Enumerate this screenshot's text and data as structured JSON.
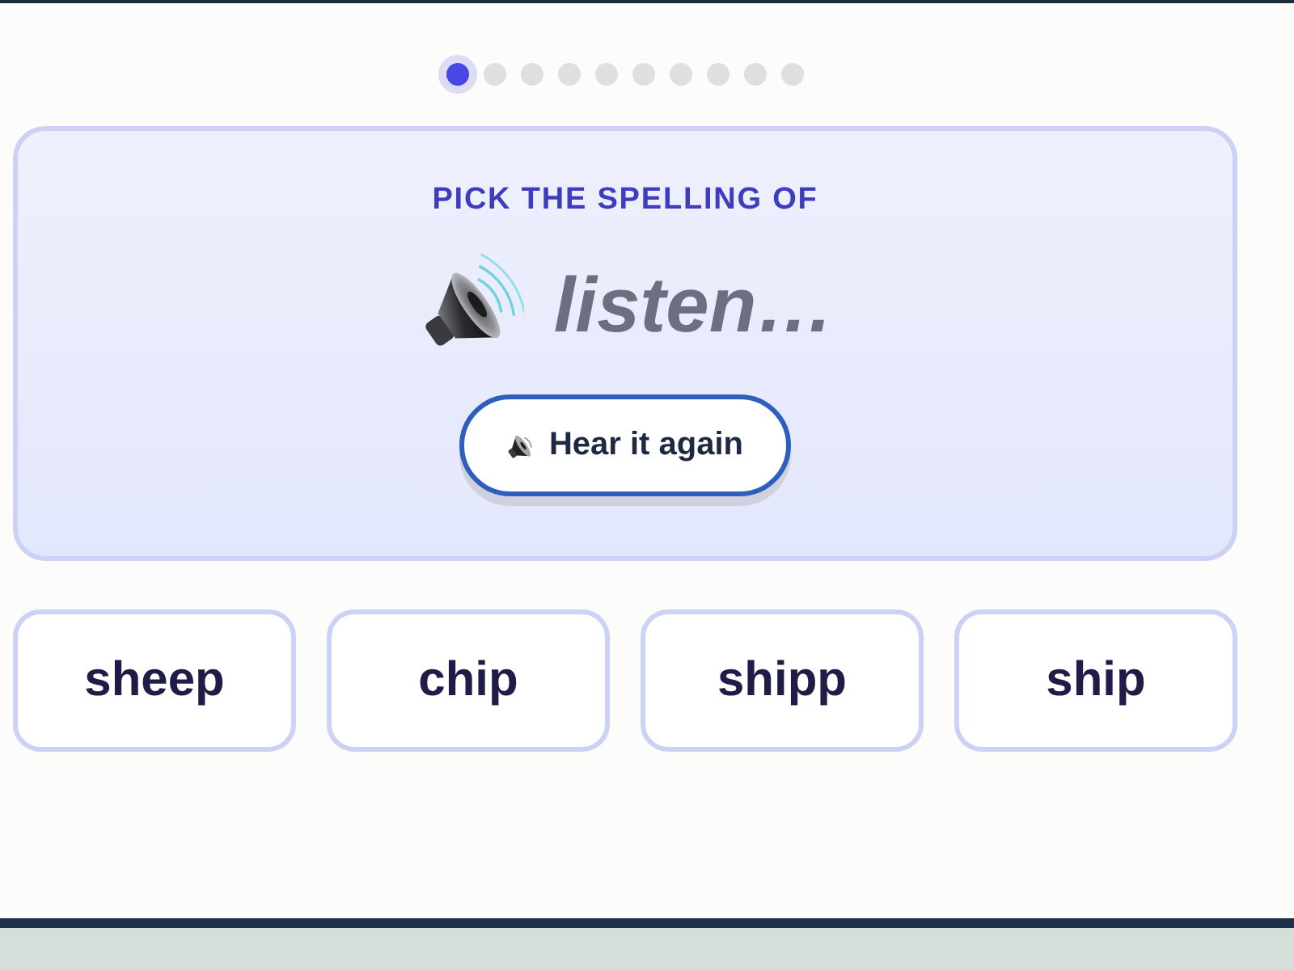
{
  "progress": {
    "steps": [
      {
        "selected": true
      },
      {
        "selected": false
      },
      {
        "selected": false
      },
      {
        "selected": false
      },
      {
        "selected": false
      },
      {
        "selected": false
      },
      {
        "selected": false
      },
      {
        "selected": false
      },
      {
        "selected": false
      },
      {
        "selected": false
      }
    ]
  },
  "prompt": {
    "title": "PICK THE SPELLING OF",
    "word": "listen…",
    "replay_button": {
      "label": "Hear it again"
    }
  },
  "options": [
    {
      "label": "sheep"
    },
    {
      "label": "chip"
    },
    {
      "label": "shipp"
    },
    {
      "label": "ship"
    }
  ]
}
